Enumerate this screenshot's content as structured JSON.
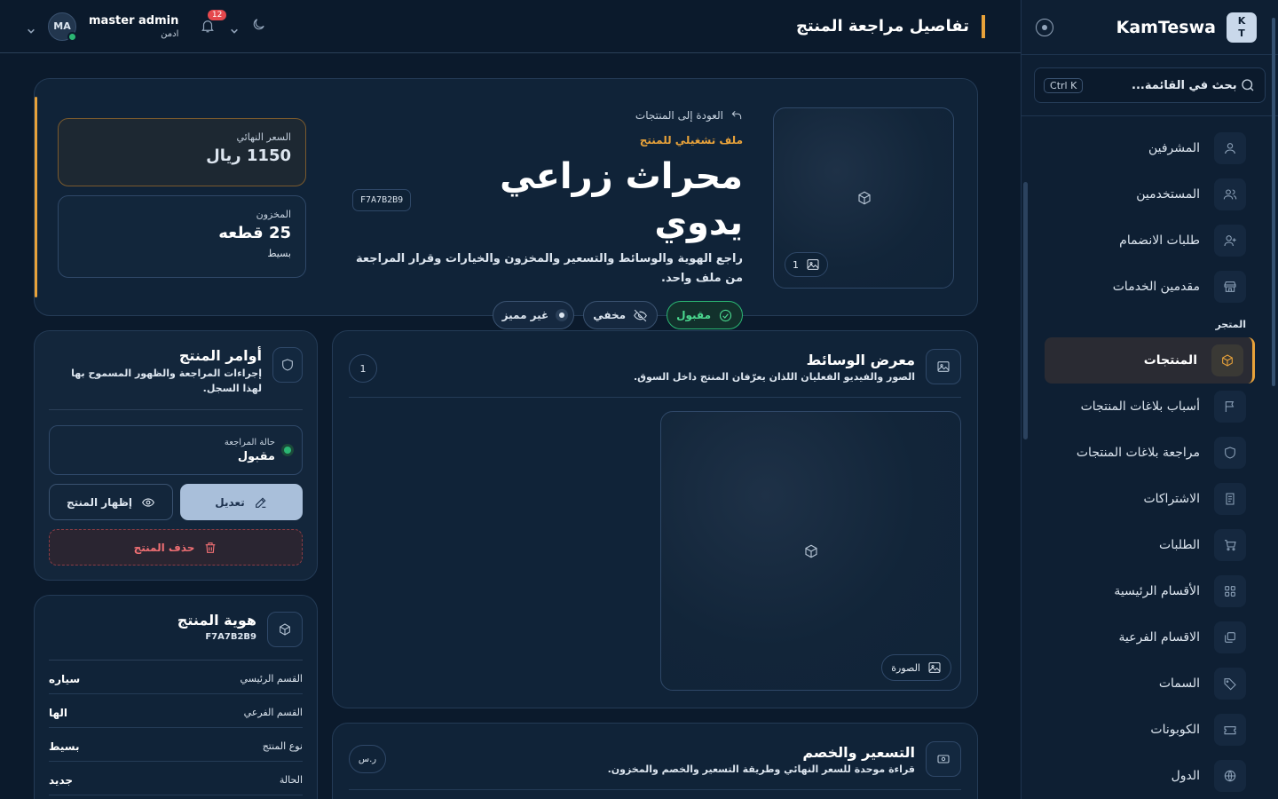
{
  "sidebar": {
    "logo_letters": [
      "K",
      "T"
    ],
    "brand": "KamTeswa",
    "search_placeholder": "بحث في القائمة...",
    "search_shortcut": "Ctrl K",
    "items_top": [
      {
        "label": "المشرفين",
        "icon": "user-icon"
      },
      {
        "label": "المستخدمين",
        "icon": "users-icon"
      },
      {
        "label": "طلبات الانضمام",
        "icon": "user-plus-icon"
      },
      {
        "label": "مقدمين الخدمات",
        "icon": "store-icon"
      }
    ],
    "section_store": "المتجر",
    "items_store": [
      {
        "label": "المنتجات",
        "icon": "box-icon",
        "active": true
      },
      {
        "label": "أسباب بلاغات المنتجات",
        "icon": "flag-icon"
      },
      {
        "label": "مراجعة بلاغات المنتجات",
        "icon": "shield-icon"
      },
      {
        "label": "الاشتراكات",
        "icon": "receipt-icon"
      },
      {
        "label": "الطلبات",
        "icon": "cart-icon"
      },
      {
        "label": "الأقسام الرئيسية",
        "icon": "grid-icon"
      },
      {
        "label": "الاقسام الفرعية",
        "icon": "layers-icon"
      },
      {
        "label": "السمات",
        "icon": "tag-icon"
      },
      {
        "label": "الكوبونات",
        "icon": "ticket-icon"
      },
      {
        "label": "الدول",
        "icon": "globe-icon"
      }
    ]
  },
  "topbar": {
    "title": "تفاصيل مراجعة المنتج",
    "user_initials": "MA",
    "user_name": "master admin",
    "user_role": "ادمن",
    "notifications": "12"
  },
  "hero": {
    "image_count": "1",
    "back_label": "العودة إلى المنتجات",
    "eyebrow": "ملف تشغيلي للمنتج",
    "title": "محراث زراعي يدوي",
    "code": "F7A7B2B9",
    "description": "راجع الهوية والوسائط والتسعير والمخزون والخيارات وقرار المراجعة من ملف واحد.",
    "chip_status": "مقبول",
    "chip_visibility": "مخفي",
    "chip_featured": "غير مميز",
    "price_label": "السعر النهائي",
    "price_value": "1150 ريال",
    "stock_label": "المخزون",
    "stock_value": "25 قطعه",
    "stock_type": "بسيط"
  },
  "gallery": {
    "title": "معرض الوسائط",
    "subtitle": "الصور والفيديو الفعليان اللذان يعرّفان المنتج داخل السوق.",
    "count": "1",
    "media_label": "الصورة"
  },
  "pricing": {
    "title": "التسعير والخصم",
    "subtitle": "قراءة موحدة للسعر النهائي وطريقة التسعير والخصم والمخزون.",
    "currency_pill": "ر.س"
  },
  "actions": {
    "title": "أوامر المنتج",
    "subtitle": "إجراءات المراجعة والظهور المسموح بها لهذا السجل.",
    "review_label": "حالة المراجعة",
    "review_value": "مقبول",
    "edit_label": "تعديل",
    "show_label": "إظهار المنتج",
    "delete_label": "حذف المنتج"
  },
  "identity": {
    "title": "هوية المنتج",
    "code": "F7A7B2B9",
    "rows": [
      {
        "key": "القسم الرئيسي",
        "value": "سياره"
      },
      {
        "key": "القسم الفرعي",
        "value": "الها"
      },
      {
        "key": "نوع المنتج",
        "value": "بسيط"
      },
      {
        "key": "الحالة",
        "value": "جديد"
      }
    ]
  },
  "colors": {
    "accent": "#e8a23a",
    "success": "#2bb673",
    "danger": "#e5484d",
    "background": "#0b1a2c"
  }
}
